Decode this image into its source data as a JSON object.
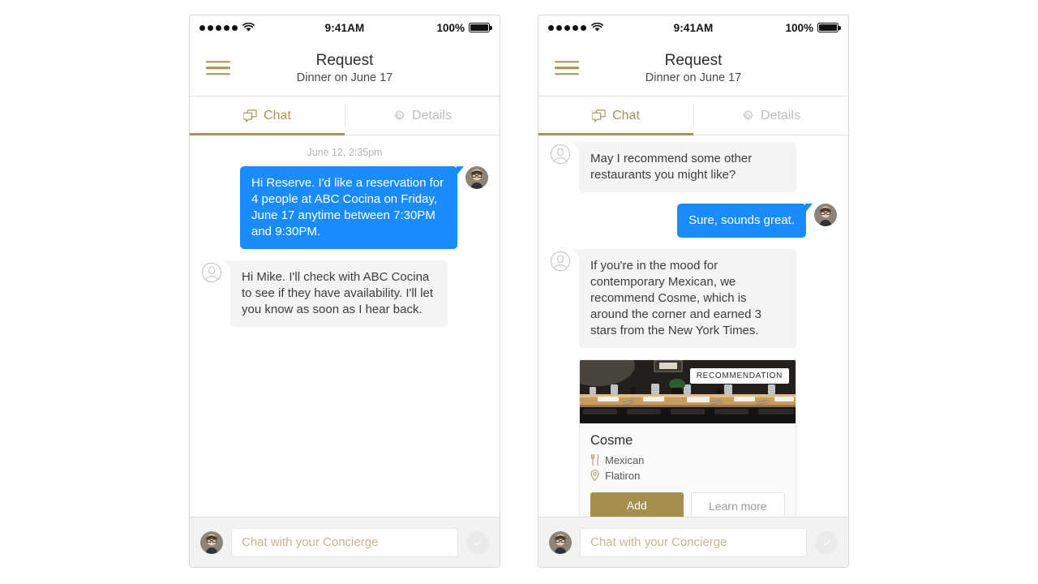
{
  "status_bar": {
    "time": "9:41AM",
    "battery_percent": "100%",
    "signal_dots": 5
  },
  "nav": {
    "title": "Request",
    "subtitle": "Dinner on June 17",
    "menu_icon": "hamburger-menu-icon"
  },
  "tabs": [
    {
      "label": "Chat",
      "icon": "chat-bubbles-icon",
      "active": true
    },
    {
      "label": "Details",
      "icon": "gear-icon",
      "active": false
    }
  ],
  "colors": {
    "gold": "#a79355",
    "blue": "#1a8cff",
    "add_button": "#a58f4c",
    "bubble_gray": "#f4f4f4"
  },
  "left_phone": {
    "timestamp": "June 12, 2:35pm",
    "messages": [
      {
        "from": "user",
        "text": "Hi Reserve. I'd like a reservation for 4 people at ABC Cocina on Friday, June 17 anytime between 7:30PM and 9:30PM."
      },
      {
        "from": "agent",
        "text": "Hi Mike. I'll check with ABC Cocina to see if they have availability. I'll let you know as soon as I hear back."
      }
    ]
  },
  "right_phone": {
    "messages": [
      {
        "from": "agent",
        "text": "May I recommend some other restaurants you might like?"
      },
      {
        "from": "user",
        "text": "Sure, sounds great."
      },
      {
        "from": "agent",
        "text": "If you're in the mood for contemporary Mexican, we recommend Cosme, which is around the corner and earned 3 stars from the New York Times."
      }
    ],
    "card": {
      "badge": "RECOMMENDATION",
      "title": "Cosme",
      "cuisine": "Mexican",
      "cuisine_icon": "fork-knife-icon",
      "location": "Flatiron",
      "location_icon": "map-pin-icon",
      "primary_button": "Add",
      "secondary_button": "Learn more"
    }
  },
  "composer": {
    "placeholder": "Chat with your Concierge",
    "value": "",
    "send_icon": "checkmark-circle-icon"
  }
}
